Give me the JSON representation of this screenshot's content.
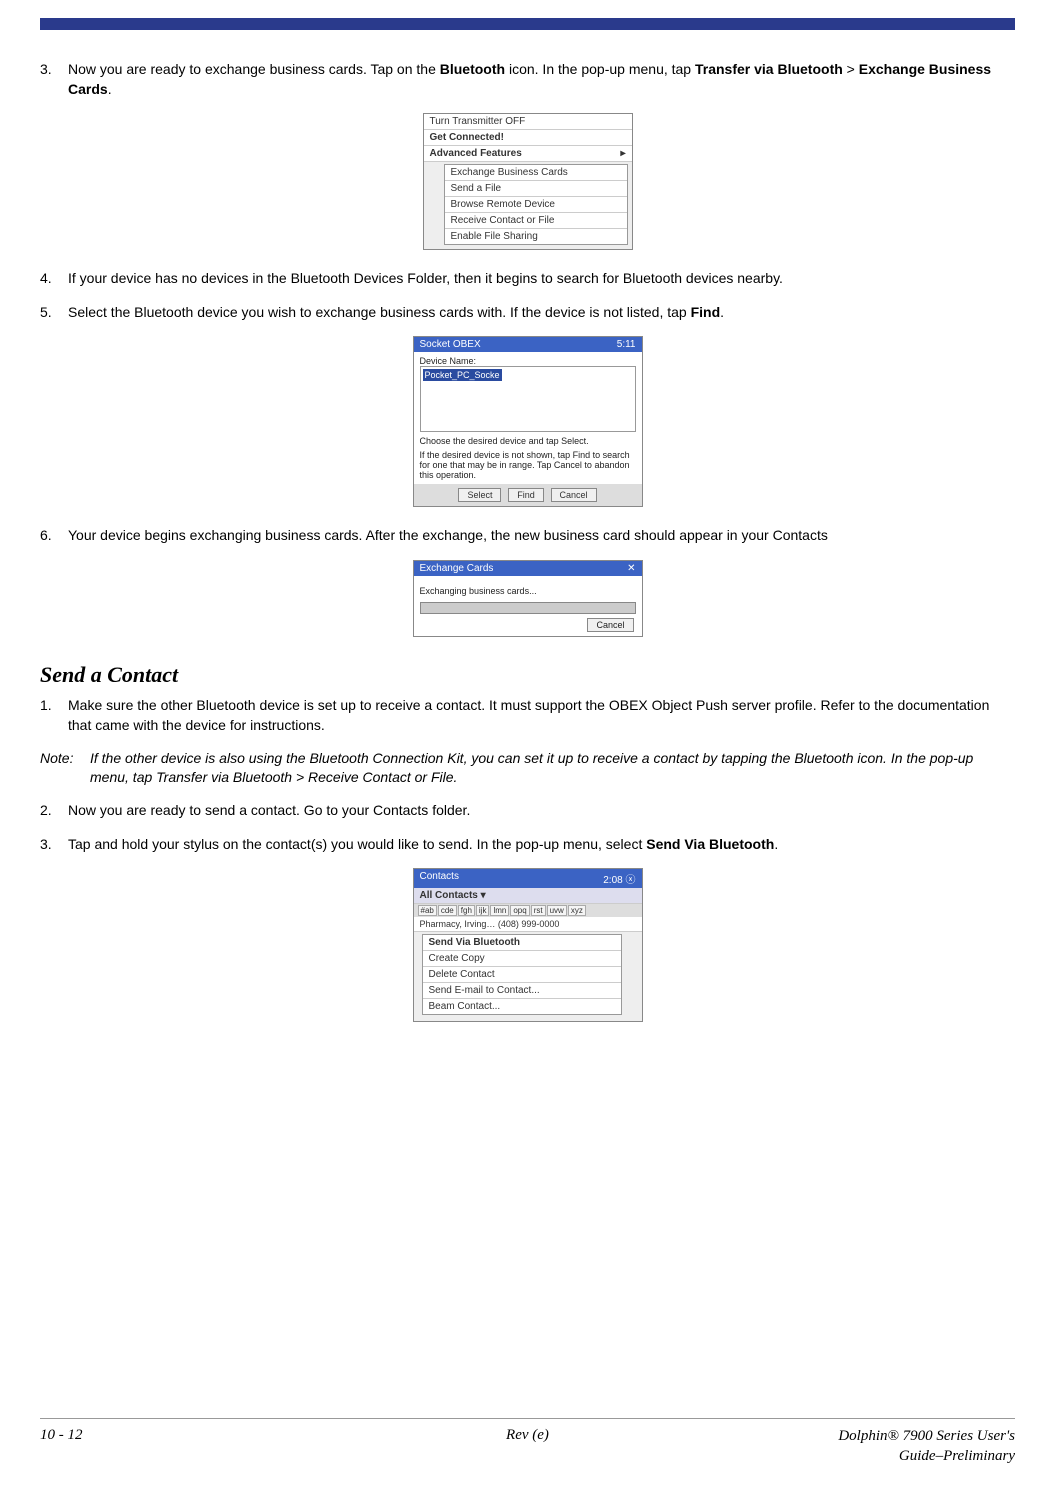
{
  "steps_a": {
    "s3": {
      "num": "3.",
      "text_before": "Now you are ready to exchange business cards. Tap on the ",
      "bold1": "Bluetooth",
      "text_mid1": " icon. In the pop-up menu, tap ",
      "bold2": "Transfer via Bluetooth",
      "text_mid2": " > ",
      "bold3": "Exchange Business Cards",
      "text_after": "."
    },
    "s4": {
      "num": "4.",
      "text": "If your device has no devices in the Bluetooth Devices Folder, then it begins to search for Bluetooth devices nearby."
    },
    "s5": {
      "num": "5.",
      "text_before": "Select the Bluetooth device you wish to exchange business cards with. If the device is not listed, tap ",
      "bold1": "Find",
      "text_after": "."
    },
    "s6": {
      "num": "6.",
      "text": "Your device begins exchanging business cards. After the exchange, the new business card should appear in your Contacts"
    }
  },
  "section_title": "Send a Contact",
  "steps_b": {
    "s1": {
      "num": "1.",
      "text": "Make sure the other Bluetooth device is set up to receive a contact. It must support the OBEX Object Push server profile. Refer to the documentation that came with the device for instructions."
    },
    "note": {
      "label": "Note:",
      "text": "If the other device is also using the Bluetooth Connection Kit, you can set it up to receive a contact by tapping the Bluetooth icon. In the pop-up menu, tap Transfer via Bluetooth > Receive Contact or File."
    },
    "s2": {
      "num": "2.",
      "text": "Now you are ready to send a contact. Go to your Contacts folder."
    },
    "s3": {
      "num": "3.",
      "text_before": "Tap and hold your stylus on the contact(s) you would like to send. In the pop-up menu, select ",
      "bold1": "Send Via Bluetooth",
      "text_after": "."
    }
  },
  "mock1": {
    "m1": "Turn Transmitter OFF",
    "m2": "Get Connected!",
    "m3": "Advanced Features",
    "sub1": "Exchange Business Cards",
    "sub2": "Send a File",
    "sub3": "Browse Remote Device",
    "sub4": "Receive Contact or File",
    "sub5": "Enable File Sharing"
  },
  "mock2": {
    "title_left": "Socket OBEX",
    "title_right": "5:11",
    "body_label": "Device Name:",
    "item": "Pocket_PC_Socke",
    "hint1": "Choose the desired device and tap Select.",
    "hint2": "If the desired device is not shown, tap Find to search for one that may be in range. Tap Cancel to abandon this operation.",
    "btn1": "Select",
    "btn2": "Find",
    "btn3": "Cancel"
  },
  "mock3": {
    "title": "Exchange Cards",
    "body": "Exchanging business cards...",
    "btn": "Cancel"
  },
  "mock4": {
    "title_left": "Contacts",
    "title_right": "2:08",
    "filter": "All Contacts ▾",
    "tabs": [
      "#ab",
      "cde",
      "fgh",
      "ijk",
      "lmn",
      "opq",
      "rst",
      "uvw",
      "xyz"
    ],
    "row": "Pharmacy, Irving… (408) 999-0000",
    "m1": "Send Via Bluetooth",
    "m2": "Create Copy",
    "m3": "Delete Contact",
    "m4": "Send E-mail to Contact...",
    "m5": "Beam Contact..."
  },
  "footer": {
    "left": "10 - 12",
    "mid": "Rev (e)",
    "right1": "Dolphin® 7900 Series User's",
    "right2": "Guide–Preliminary"
  }
}
